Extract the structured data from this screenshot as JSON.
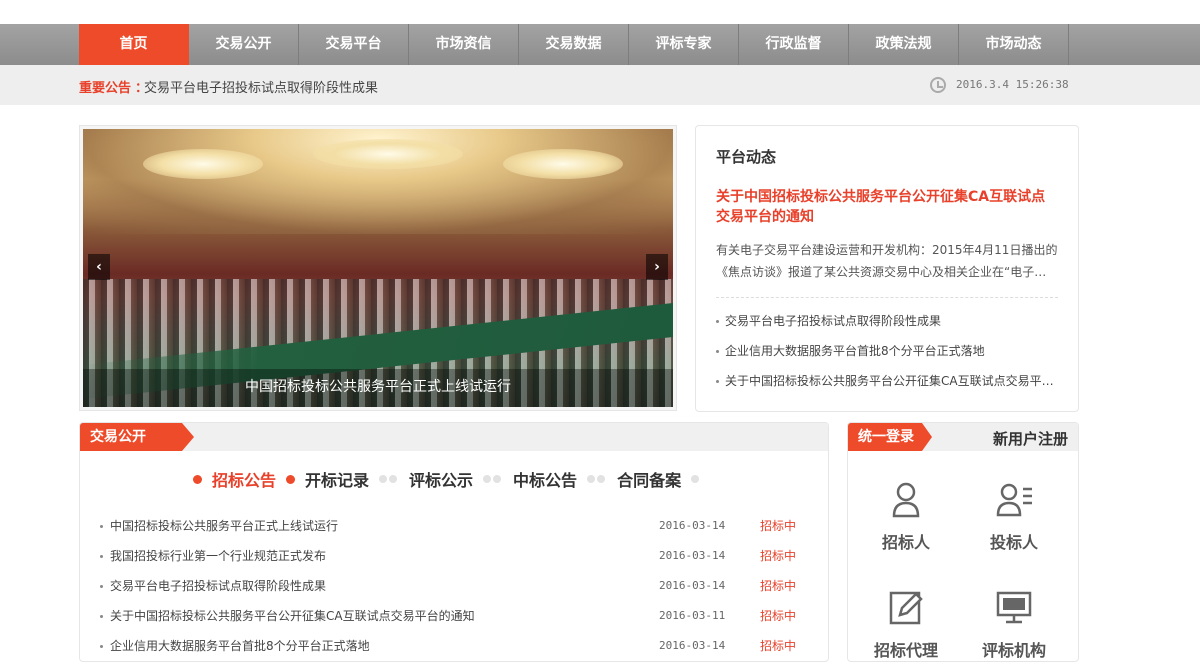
{
  "nav": {
    "items": [
      "首页",
      "交易公开",
      "交易平台",
      "市场资信",
      "交易数据",
      "评标专家",
      "行政监督",
      "政策法规",
      "市场动态"
    ]
  },
  "notice": {
    "label": "重要公告",
    "separator": "：",
    "text": "交易平台电子招投标试点取得阶段性成果",
    "datetime": "2016.3.4 15:26:38"
  },
  "slider": {
    "caption": "中国招标投标公共服务平台正式上线试运行",
    "prev": "‹",
    "next": "›"
  },
  "dynamic": {
    "title": "平台动态",
    "headline": "关于中国招标投标公共服务平台公开征集CA互联试点交易平台的通知",
    "desc": "有关电子交易平台建设运营和开发机构：2015年4月11日播出的《焦点访谈》报道了某公共资源交易中心及相关企业在“电子…",
    "list": [
      "交易平台电子招投标试点取得阶段性成果",
      "企业信用大数据服务平台首批8个分平台正式落地",
      "关于中国招标投标公共服务平台公开征集CA互联试点交易平…"
    ]
  },
  "trade": {
    "tag": "交易公开",
    "tabs": [
      "招标公告",
      "开标记录",
      "评标公示",
      "中标公告",
      "合同备案"
    ],
    "rows": [
      {
        "title": "中国招标投标公共服务平台正式上线试运行",
        "date": "2016-03-14",
        "status": "招标中"
      },
      {
        "title": "我国招投标行业第一个行业规范正式发布",
        "date": "2016-03-14",
        "status": "招标中"
      },
      {
        "title": "交易平台电子招投标试点取得阶段性成果",
        "date": "2016-03-14",
        "status": "招标中"
      },
      {
        "title": "关于中国招标投标公共服务平台公开征集CA互联试点交易平台的通知",
        "date": "2016-03-11",
        "status": "招标中"
      },
      {
        "title": "企业信用大数据服务平台首批8个分平台正式落地",
        "date": "2016-03-14",
        "status": "招标中"
      }
    ]
  },
  "login": {
    "tag": "统一登录",
    "register": "新用户注册",
    "roles": [
      "招标人",
      "投标人",
      "招标代理",
      "评标机构"
    ]
  },
  "colors": {
    "accent": "#ee4b2b",
    "nav": "#999999"
  }
}
